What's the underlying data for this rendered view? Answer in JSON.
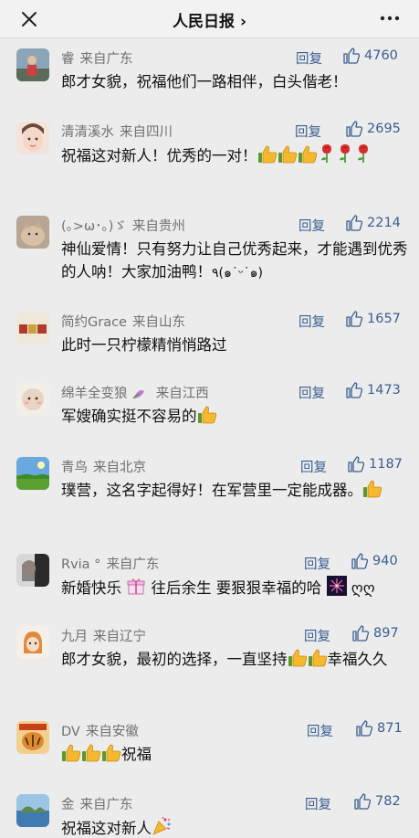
{
  "header": {
    "title": "人民日报 ›",
    "close_icon": "close-icon",
    "more_icon": "more-icon"
  },
  "comments": [
    {
      "user": "睿",
      "from": "来自广东",
      "reply": "回复",
      "likes": "4760",
      "parts": [
        "郎才女貌，祝福他们一路相伴，白头偕老！"
      ]
    },
    {
      "user": "清清溪水",
      "from": "来自四川",
      "reply": "回复",
      "likes": "2695",
      "parts": [
        "祝福这对新人！优秀的一对！"
      ]
    },
    {
      "user": "(｡>ω･｡)ゞ",
      "from": "来自贵州",
      "reply": "回复",
      "likes": "2214",
      "parts": [
        "神仙爱情！只有努力让自己优秀起来，才能遇到优秀的人呐！大家加油鸭！",
        "٩(๑˙ᵕ˙๑)"
      ]
    },
    {
      "user": "简约Grace",
      "from": "来自山东",
      "reply": "回复",
      "likes": "1657",
      "parts": [
        "此时一只柠檬精悄悄路过"
      ]
    },
    {
      "user": "绵羊全变狼",
      "from": "来自江西",
      "reply": "回复",
      "likes": "1473",
      "parts": [
        "军嫂确实挺不容易的"
      ]
    },
    {
      "user": "青鸟",
      "from": "来自北京",
      "reply": "回复",
      "likes": "1187",
      "parts": [
        "璞营，这名字起得好！在军营里一定能成器。"
      ]
    },
    {
      "user": "Rvia °",
      "from": "来自广东",
      "reply": "回复",
      "likes": "940",
      "parts": [
        "新婚快乐",
        "往后余生 要狠狠幸福的哈",
        "ღღ"
      ]
    },
    {
      "user": "九月",
      "from": "来自辽宁",
      "reply": "回复",
      "likes": "897",
      "parts": [
        "郎才女貌，最初的选择，一直坚持",
        "幸福久久"
      ]
    },
    {
      "user": "DV",
      "from": "来自安徽",
      "reply": "回复",
      "likes": "871",
      "parts": [
        "祝福"
      ]
    },
    {
      "user": "金",
      "from": "来自广东",
      "reply": "回复",
      "likes": "782",
      "parts": [
        "祝福这对新人"
      ]
    }
  ],
  "icons": {
    "thumb": "thumbs-up-icon",
    "rose": "rose-icon",
    "gift": "gift-icon",
    "firework": "firework-icon",
    "party": "party-popper-icon"
  },
  "colors": {
    "link": "#3b5e8f",
    "meta": "#707070",
    "background": "#ececec"
  }
}
